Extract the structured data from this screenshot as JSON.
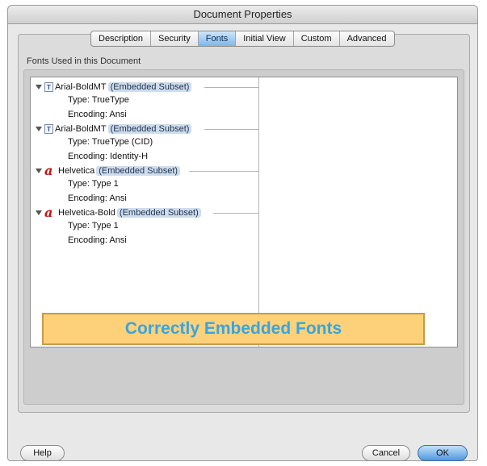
{
  "window": {
    "title": "Document Properties"
  },
  "tabs": [
    {
      "label": "Description",
      "active": false
    },
    {
      "label": "Security",
      "active": false
    },
    {
      "label": "Fonts",
      "active": true
    },
    {
      "label": "Initial View",
      "active": false
    },
    {
      "label": "Custom",
      "active": false
    },
    {
      "label": "Advanced",
      "active": false
    }
  ],
  "fonts_group": {
    "label": "Fonts Used in this Document"
  },
  "fonts": [
    {
      "name": "Arial-BoldMT",
      "status": "(Embedded Subset)",
      "icon": "truetype-font-icon",
      "type": "Type: TrueType",
      "encoding": "Encoding: Ansi"
    },
    {
      "name": "Arial-BoldMT",
      "status": "(Embedded Subset)",
      "icon": "truetype-font-icon",
      "type": "Type: TrueType (CID)",
      "encoding": "Encoding: Identity-H"
    },
    {
      "name": "Helvetica",
      "status": "(Embedded Subset)",
      "icon": "type1-font-icon",
      "type": "Type: Type 1",
      "encoding": "Encoding: Ansi"
    },
    {
      "name": "Helvetica-Bold",
      "status": "(Embedded Subset)",
      "icon": "type1-font-icon",
      "type": "Type: Type 1",
      "encoding": "Encoding: Ansi"
    }
  ],
  "icons": {
    "truetype_glyph": "T",
    "type1_glyph": "a"
  },
  "banner": {
    "text": "Correctly Embedded Fonts"
  },
  "buttons": {
    "help": "Help",
    "cancel": "Cancel",
    "ok": "OK"
  },
  "colors": {
    "accent": "#5fa8e8",
    "banner_bg": "#fcd17a",
    "banner_text": "#3aa4df",
    "type1_icon": "#cc1010"
  }
}
